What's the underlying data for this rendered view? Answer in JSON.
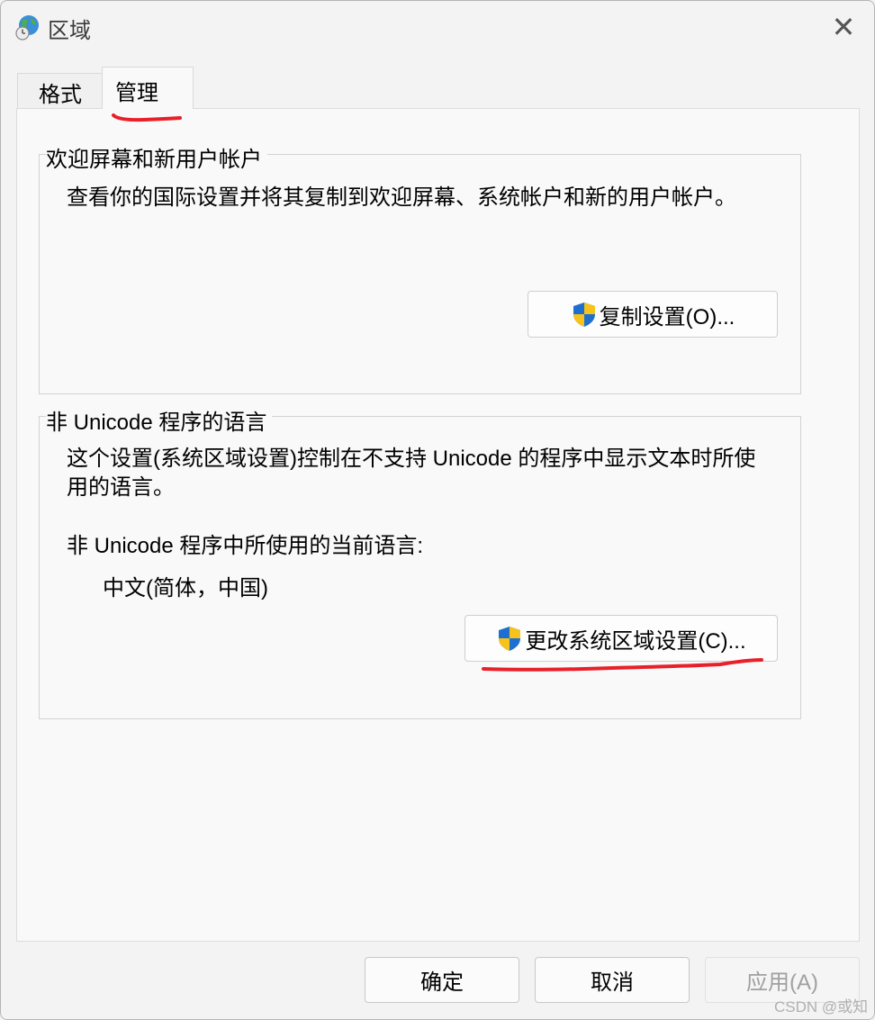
{
  "window": {
    "title": "区域",
    "close_glyph": "✕"
  },
  "tabs": [
    {
      "label": "格式",
      "selected": false
    },
    {
      "label": "管理",
      "selected": true
    }
  ],
  "welcome_group": {
    "legend": "欢迎屏幕和新用户帐户",
    "description": "查看你的国际设置并将其复制到欢迎屏幕、系统帐户和新的用户帐户。",
    "button_label": "复制设置(O)...",
    "button_icon": "uac-shield-icon"
  },
  "nonunicode_group": {
    "legend": "非 Unicode 程序的语言",
    "description_line1": "这个设置(系统区域设置)控制在不支持 Unicode 的程序中显示文本时所使",
    "description_line2": "用的语言。",
    "current_label": "非 Unicode 程序中所使用的当前语言:",
    "current_value": "中文(简体，中国)",
    "button_label": "更改系统区域设置(C)...",
    "button_icon": "uac-shield-icon"
  },
  "footer": {
    "ok_label": "确定",
    "cancel_label": "取消",
    "apply_label": "应用(A)",
    "apply_enabled": false
  },
  "watermark": "CSDN @或知",
  "colors": {
    "annotation_red": "#e8202a",
    "shield_blue": "#1f6fd1",
    "shield_yellow": "#f7c31a"
  }
}
